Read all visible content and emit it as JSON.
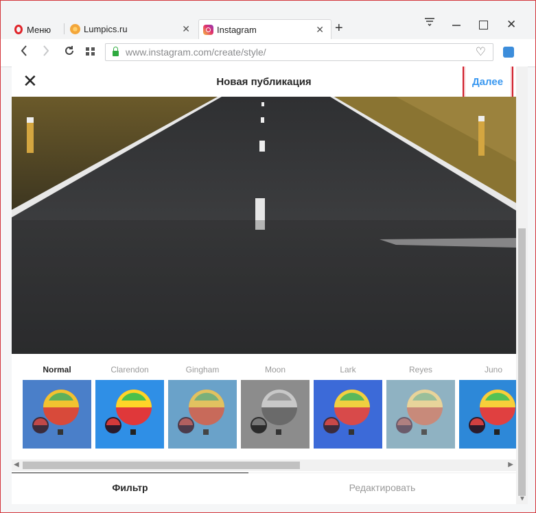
{
  "browser": {
    "menu_label": "Меню",
    "tabs": [
      {
        "title": "Lumpics.ru",
        "active": false
      },
      {
        "title": "Instagram",
        "active": true
      }
    ],
    "new_tab_symbol": "+",
    "address": {
      "domain": "www.instagram.com",
      "path": "/create/style/"
    }
  },
  "header": {
    "close_symbol": "✕",
    "title": "Новая публикация",
    "next_label": "Далее"
  },
  "filters": [
    {
      "name": "Normal",
      "selected": true
    },
    {
      "name": "Clarendon",
      "selected": false
    },
    {
      "name": "Gingham",
      "selected": false
    },
    {
      "name": "Moon",
      "selected": false
    },
    {
      "name": "Lark",
      "selected": false
    },
    {
      "name": "Reyes",
      "selected": false
    },
    {
      "name": "Juno",
      "selected": false
    }
  ],
  "bottom_tabs": {
    "filter": "Фильтр",
    "edit": "Редактировать"
  },
  "colors": {
    "accent": "#3897f0",
    "highlight_border": "#cf1d2a",
    "opera_red": "#e0242a"
  }
}
